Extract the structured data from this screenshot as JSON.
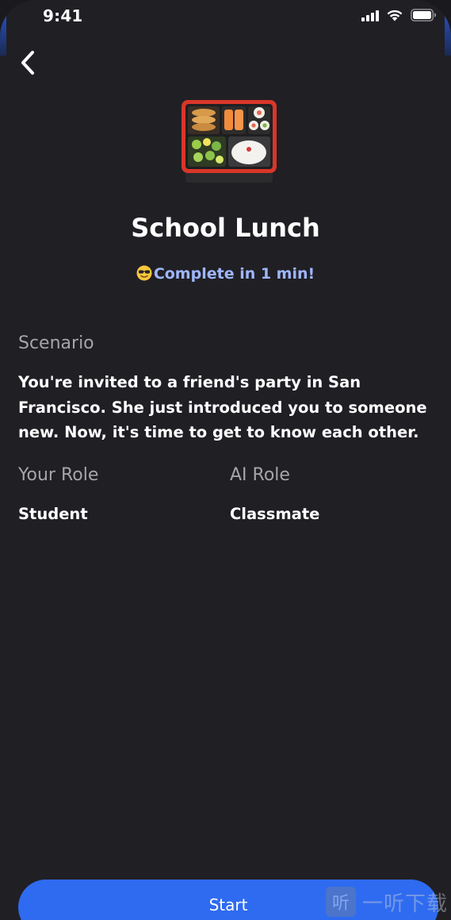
{
  "status_bar": {
    "time": "9:41"
  },
  "header": {
    "back_icon": "chevron-left-icon"
  },
  "lesson": {
    "icon": "bento-box-icon",
    "title": "School Lunch",
    "duration_emoji": "smiling-face-with-sunglasses",
    "duration": "Complete in 1 min!"
  },
  "scenario": {
    "label": "Scenario",
    "text": "You're invited to a friend's party in San Francisco. She just introduced you to someone new. Now, it's time to get to know each other."
  },
  "roles": {
    "your_role_label": "Your Role",
    "your_role": "Student",
    "ai_role_label": "AI Role",
    "ai_role": "Classmate"
  },
  "actions": {
    "start_label": "Start"
  },
  "watermark": {
    "logo": "听",
    "text": "一听下载"
  },
  "colors": {
    "background": "#201f24",
    "accent": "#2f6bf0",
    "duration_text": "#9fb6ff",
    "muted_label": "#a5a5aa"
  }
}
